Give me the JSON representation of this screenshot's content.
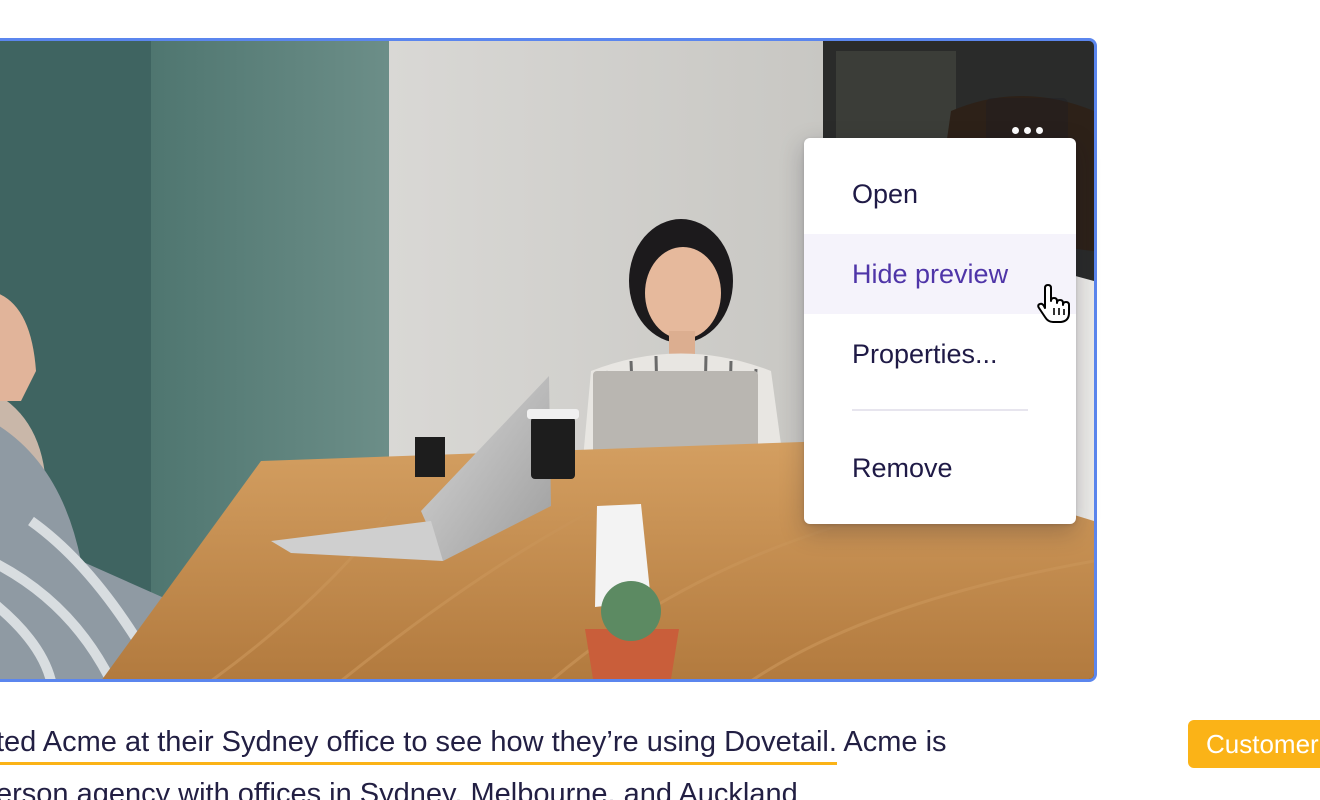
{
  "image": {
    "more_icon": "more-horizontal-icon"
  },
  "context_menu": {
    "items": [
      {
        "label": "Open"
      },
      {
        "label": "Hide preview",
        "state": "hovered"
      },
      {
        "label": "Properties..."
      },
      {
        "label": "Remove"
      }
    ]
  },
  "body_text": {
    "line1_highlighted": "ted Acme at their Sydney office to see how they’re using Dovetail.",
    "line1_rest": " Acme is",
    "line2": "erson agency with offices in Sydney, Melbourne, and Auckland"
  },
  "tag": {
    "label": "Customer",
    "color": "#fbb317"
  },
  "colors": {
    "accent": "#5b86ee",
    "text": "#221f43",
    "menu_hover_text": "#4f35a8",
    "highlight": "#fbb317"
  }
}
